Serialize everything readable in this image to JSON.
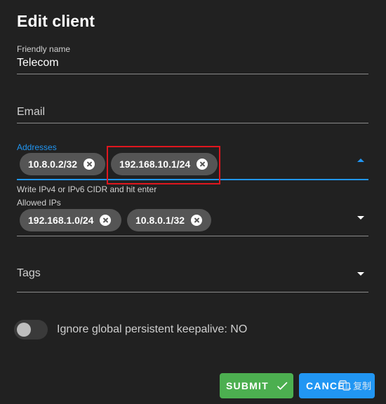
{
  "dialog": {
    "title": "Edit client"
  },
  "fields": {
    "friendly_name": {
      "label": "Friendly name",
      "value": "Telecom"
    },
    "email": {
      "label": "Email",
      "value": ""
    },
    "addresses": {
      "label": "Addresses",
      "chips": [
        "10.8.0.2/32",
        "192.168.10.1/24"
      ],
      "hint": "Write IPv4 or IPv6 CIDR and hit enter"
    },
    "allowed_ips": {
      "label": "Allowed IPs",
      "chips": [
        "192.168.1.0/24",
        "10.8.0.1/32"
      ]
    },
    "tags": {
      "label": "Tags"
    }
  },
  "switch": {
    "label": "Ignore global persistent keepalive: NO",
    "checked": false
  },
  "buttons": {
    "submit": "SUBMIT",
    "cancel": "CANCEL"
  },
  "watermark": {
    "text": "复制"
  },
  "colors": {
    "background": "#212121",
    "accent": "#2196f3",
    "submit": "#4caf50",
    "chip": "#555555",
    "highlight": "#e0161e"
  },
  "icons": {
    "chip_remove": "close-circle-icon",
    "dropdown": "menu-down-icon",
    "submit": "check-icon"
  }
}
